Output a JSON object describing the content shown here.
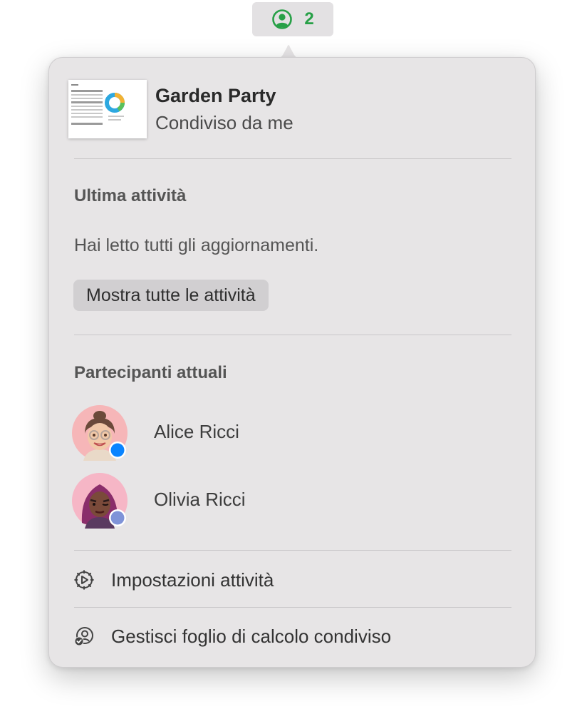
{
  "collaborate": {
    "count": "2",
    "icon": "person-circle-icon",
    "accent": "#27a047"
  },
  "document": {
    "title": "Garden Party",
    "subtitle": "Condiviso da me"
  },
  "activity": {
    "heading": "Ultima attività",
    "status": "Hai letto tutti gli aggiornamenti.",
    "show_all_label": "Mostra tutte le attività"
  },
  "participants": {
    "heading": "Partecipanti attuali",
    "items": [
      {
        "name": "Alice Ricci",
        "status_color": "#0a84ff"
      },
      {
        "name": "Olivia Ricci",
        "status_color": "#7f93d8"
      }
    ]
  },
  "menu": {
    "activity_settings_label": "Impostazioni attività",
    "activity_settings_icon": "gear-icon",
    "manage_label": "Gestisci foglio di calcolo condiviso",
    "manage_icon": "manage-shared-icon"
  }
}
